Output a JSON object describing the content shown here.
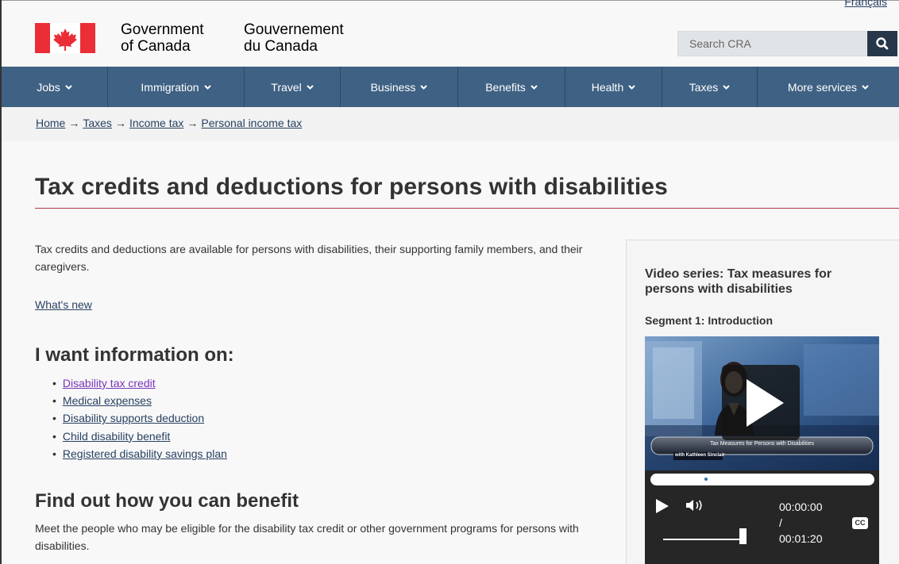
{
  "header": {
    "language_link": "Français",
    "signature_en": [
      "Government",
      "of Canada"
    ],
    "signature_fr": [
      "Gouvernement",
      "du Canada"
    ],
    "search_placeholder": "Search CRA",
    "colors": {
      "flag_red": "#eb2d37",
      "menu_bg": "#3f6183",
      "search_button": "#26374a",
      "title_rule": "#af3c43"
    }
  },
  "menu": {
    "items": [
      {
        "label": "Jobs"
      },
      {
        "label": "Immigration"
      },
      {
        "label": "Travel"
      },
      {
        "label": "Business"
      },
      {
        "label": "Benefits"
      },
      {
        "label": "Health"
      },
      {
        "label": "Taxes"
      },
      {
        "label": "More services"
      }
    ]
  },
  "breadcrumb": {
    "items": [
      "Home",
      "Taxes",
      "Income tax",
      "Personal income tax"
    ]
  },
  "page": {
    "title": "Tax credits and deductions for persons with disabilities",
    "intro": "Tax credits and deductions are available for persons with disabilities, their supporting family members, and their caregivers.",
    "whats_new": "What's new",
    "section1_heading": "I want information on:",
    "links": [
      "Disability tax credit",
      "Medical expenses",
      "Disability supports deduction",
      "Child disability benefit",
      "Registered disability savings plan"
    ],
    "section2_heading": "Find out how you can benefit",
    "section2_text": "Meet the people who may be eligible for the disability tax credit or other government programs for persons with disabilities."
  },
  "aside": {
    "title": "Video series: Tax measures for persons with disabilities",
    "segment": "Segment 1: Introduction",
    "video": {
      "banner_title": "Tax Measures for Persons with Disabilities",
      "banner_subtitle": "with Kathleen Sinclair",
      "current_time": "00:00:00",
      "separator": "/",
      "duration": "00:01:20",
      "captions_label": "CC",
      "volume_level": 1.0
    }
  }
}
